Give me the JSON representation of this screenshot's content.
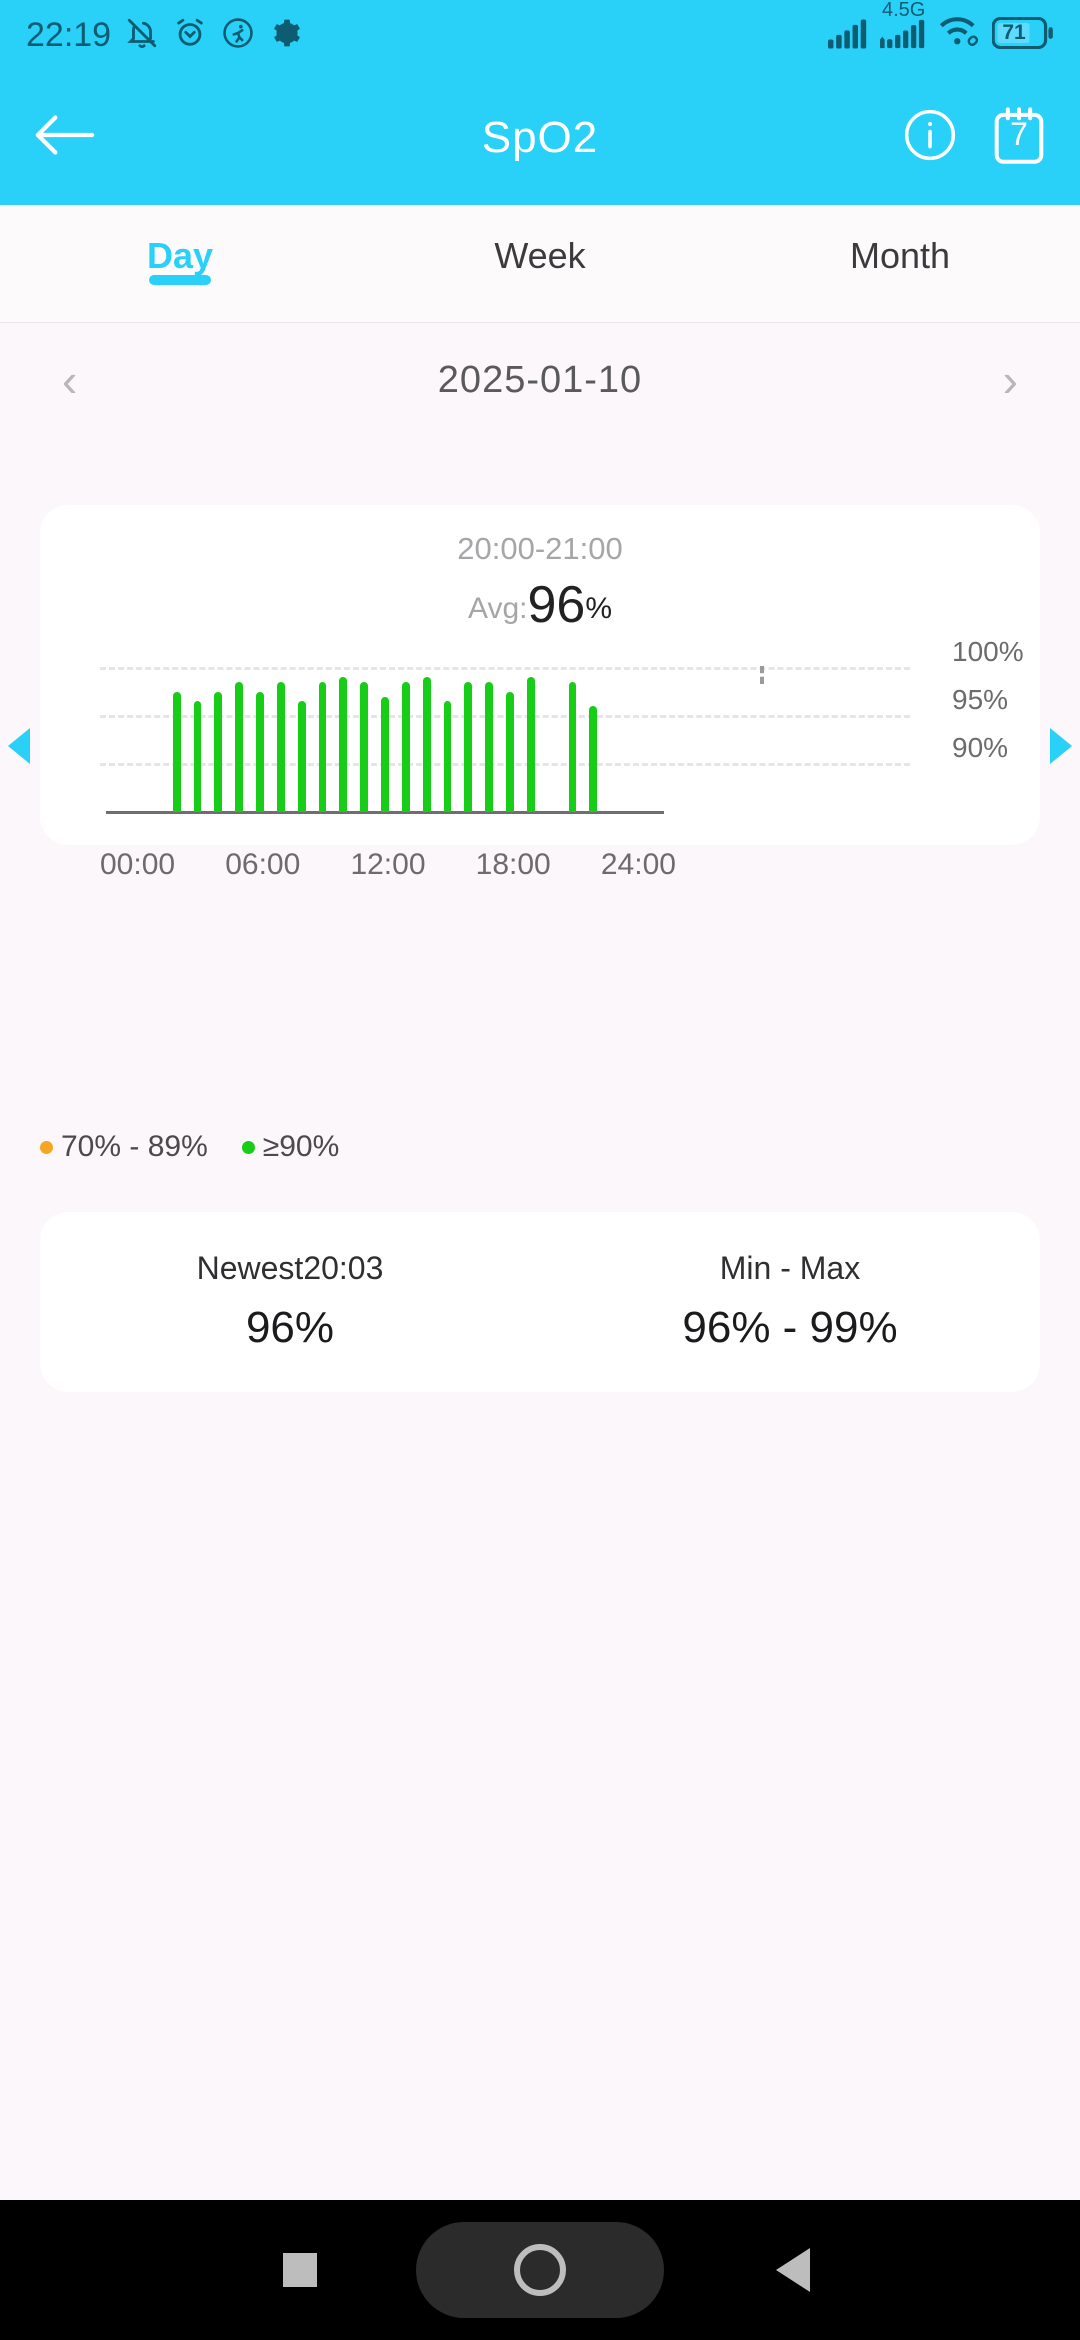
{
  "statusbar": {
    "time": "22:19",
    "icons_left": [
      "bell-off-icon",
      "alarm-clock-icon",
      "running-person-icon",
      "gear-icon"
    ],
    "network_label": "4.5G",
    "battery_level": "71",
    "icons_right": [
      "signal-icon",
      "signal-4g-icon",
      "wifi-link-icon",
      "battery-icon"
    ]
  },
  "appbar": {
    "title": "SpO2",
    "back_icon": "back-arrow-icon",
    "info_icon": "info-circle-icon",
    "calendar_icon": "calendar-icon",
    "calendar_day": "7",
    "bg_color": "#29D0F8"
  },
  "tabs": [
    {
      "label": "Day",
      "active": true
    },
    {
      "label": "Week",
      "active": false
    },
    {
      "label": "Month",
      "active": false
    }
  ],
  "datenav": {
    "prev_icon": "chevron-left-icon",
    "next_icon": "chevron-right-icon",
    "date": "2025-01-10"
  },
  "chart_card": {
    "range": "20:00-21:00",
    "avg_prefix": "Avg:",
    "avg_value": "96",
    "avg_unit": "%"
  },
  "legend": [
    {
      "label": "70% - 89%",
      "color": "#F5A623"
    },
    {
      "label": "≥90%",
      "color": "#17CD17"
    }
  ],
  "stats": [
    {
      "title": "Newest20:03",
      "value": "96%"
    },
    {
      "title": "Min - Max",
      "value": "96% - 99%"
    }
  ],
  "side_arrows": {
    "left": "prev-arrow-icon",
    "right": "next-arrow-icon"
  },
  "navbar": {
    "recent": "recents-square-icon",
    "home": "home-circle-icon",
    "back": "back-triangle-icon"
  },
  "chart_data": {
    "type": "bar",
    "title": "SpO2 per hour",
    "xlabel": "",
    "ylabel": "%",
    "ylim": [
      85,
      101
    ],
    "grid": true,
    "gridlines": [
      100,
      95,
      90
    ],
    "ytick_labels": [
      "100%",
      "95%",
      "90%"
    ],
    "xtick_labels": [
      "00:00",
      "06:00",
      "12:00",
      "18:00",
      "24:00"
    ],
    "bar_color": "#17CD17",
    "selected_index": 20,
    "selected_label": "20:00-21:00",
    "categories": [
      "00:00",
      "01:00",
      "02:00",
      "03:00",
      "04:00",
      "05:00",
      "06:00",
      "07:00",
      "08:00",
      "09:00",
      "10:00",
      "11:00",
      "12:00",
      "13:00",
      "14:00",
      "15:00",
      "16:00",
      "17:00",
      "18:00",
      "19:00",
      "20:00",
      "21:00",
      "22:00",
      "23:00"
    ],
    "values": [
      null,
      97.5,
      96.5,
      97.5,
      98.5,
      97.5,
      98.5,
      96.5,
      98.5,
      99.0,
      98.5,
      97.0,
      98.5,
      99.0,
      96.5,
      98.5,
      98.5,
      97.5,
      99.0,
      null,
      98.5,
      96.0,
      null,
      null
    ]
  }
}
